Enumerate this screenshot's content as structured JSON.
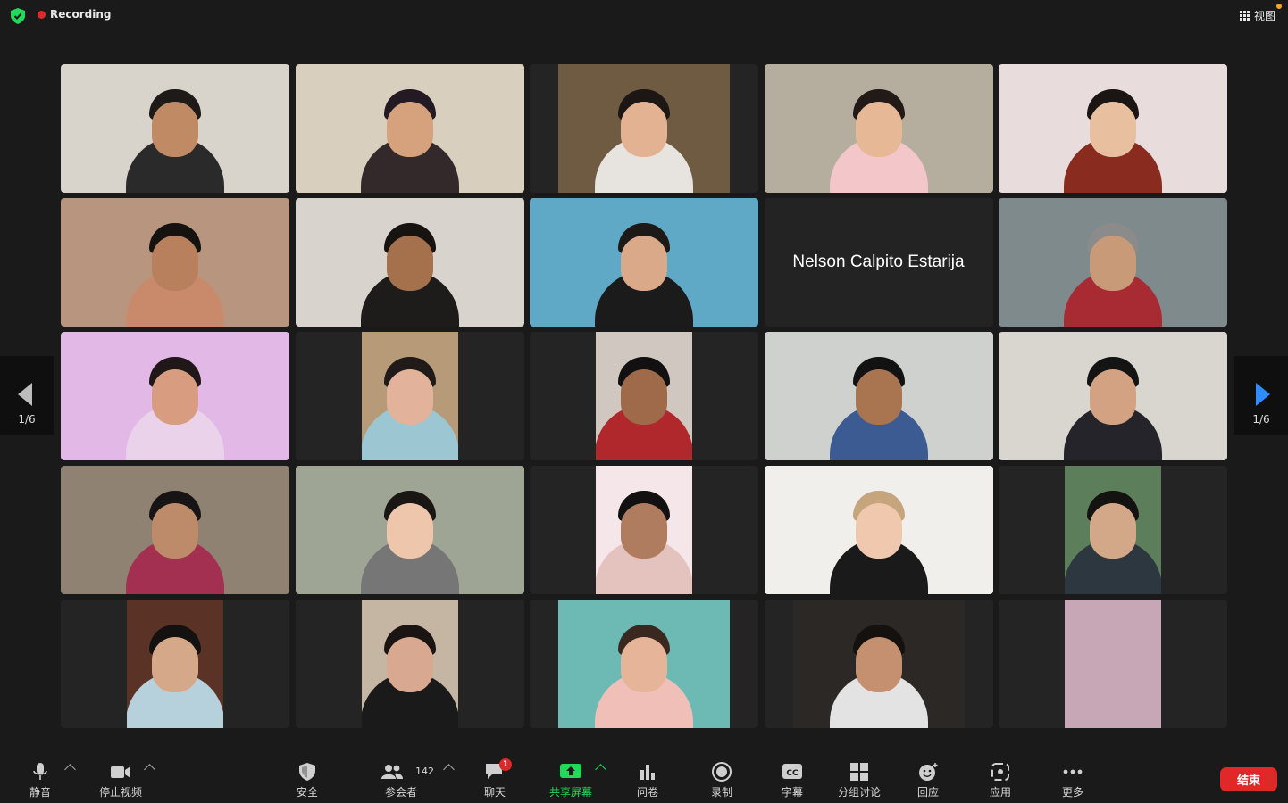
{
  "topbar": {
    "recording_label": "Recording",
    "view_label": "视图"
  },
  "pager": {
    "left_label": "1/6",
    "right_label": "1/6"
  },
  "participants": [
    {
      "bg": "#d8d4cc",
      "shirt": "#2a2a2a",
      "skin": "#c08a64",
      "hair": "#1e1a18"
    },
    {
      "bg": "#d9cfbf",
      "shirt": "#33282a",
      "skin": "#d6a27e",
      "hair": "#241a24"
    },
    {
      "bg": "#6f5b42",
      "shirt": "#e7e4e0",
      "skin": "#e3b293",
      "hair": "#1c1614"
    },
    {
      "bg": "#b5ae9e",
      "shirt": "#f3c6c9",
      "skin": "#e6b896",
      "hair": "#221a16"
    },
    {
      "bg": "#e8dcdc",
      "shirt": "#8a2b1f",
      "skin": "#e8c0a0",
      "hair": "#1b1514"
    },
    {
      "bg": "#b7957e",
      "shirt": "#c98a6c",
      "skin": "#b8805c",
      "hair": "#161210"
    },
    {
      "bg": "#d8d3cc",
      "shirt": "#1e1c1a",
      "skin": "#a4714c",
      "hair": "#171310"
    },
    {
      "bg": "#5fa8c6",
      "shirt": "#1b1b1b",
      "skin": "#d9a98a",
      "hair": "#1d1917"
    },
    {
      "name_only": "Nelson  Calpito Estarija"
    },
    {
      "bg": "#7f8a8c",
      "shirt": "#a82b34",
      "skin": "#c99a78",
      "hair": "#8b8b8b"
    },
    {
      "bg": "#e2b8e6",
      "shirt": "#e9d2ea",
      "skin": "#d89c80",
      "hair": "#201818"
    },
    {
      "bg": "#b79b78",
      "shirt": "#9cc6d2",
      "skin": "#e2b39a",
      "hair": "#201a18"
    },
    {
      "bg": "#cfc7c0",
      "shirt": "#b0282c",
      "skin": "#9f6a4a",
      "hair": "#121010"
    },
    {
      "bg": "#cfd1cf",
      "shirt": "#3c5b93",
      "skin": "#a87550",
      "hair": "#121212"
    },
    {
      "bg": "#d9d6d0",
      "shirt": "#24242a",
      "skin": "#d2a282",
      "hair": "#141414"
    },
    {
      "bg": "#8f8272",
      "shirt": "#a33050",
      "skin": "#bd8a6a",
      "hair": "#161414"
    },
    {
      "bg": "#9fa595",
      "shirt": "#767676",
      "skin": "#edc6ac",
      "hair": "#1a1614"
    },
    {
      "bg": "#f5e6ea",
      "shirt": "#e4c2be",
      "skin": "#b07c60",
      "hair": "#121010"
    },
    {
      "bg": "#f1efec",
      "shirt": "#1a1a1a",
      "skin": "#efc8ae",
      "hair": "#c6a47c"
    },
    {
      "bg": "#5d7e5b",
      "shirt": "#2d3740",
      "skin": "#d3a888",
      "hair": "#151311"
    },
    {
      "bg": "#5a3326",
      "shirt": "#b6d0dc",
      "skin": "#d4a888",
      "hair": "#141210"
    },
    {
      "bg": "#c4b6a2",
      "shirt": "#1a1a1a",
      "skin": "#d8a890",
      "hair": "#1a1412"
    },
    {
      "bg": "#6dbab4",
      "shirt": "#f0c0b8",
      "skin": "#e6b498",
      "hair": "#3a2820"
    },
    {
      "bg": "#2c2826",
      "shirt": "#e3e3e3",
      "skin": "#c49070",
      "hair": "#15110f"
    },
    {
      "bg": "#c7a6b6",
      "shirt": "#c7a6b6",
      "skin": "#c7a6b6",
      "hair": "#c7a6b6"
    }
  ],
  "toolbar": {
    "mute_label": "静音",
    "video_label": "停止视频",
    "security_label": "安全",
    "participants_label": "参会者",
    "participants_count": "142",
    "chat_label": "聊天",
    "chat_badge": "1",
    "share_label": "共享屏幕",
    "polls_label": "问卷",
    "record_label": "录制",
    "cc_label": "字幕",
    "breakout_label": "分组讨论",
    "reactions_label": "回应",
    "apps_label": "应用",
    "more_label": "更多",
    "end_label": "结束"
  }
}
